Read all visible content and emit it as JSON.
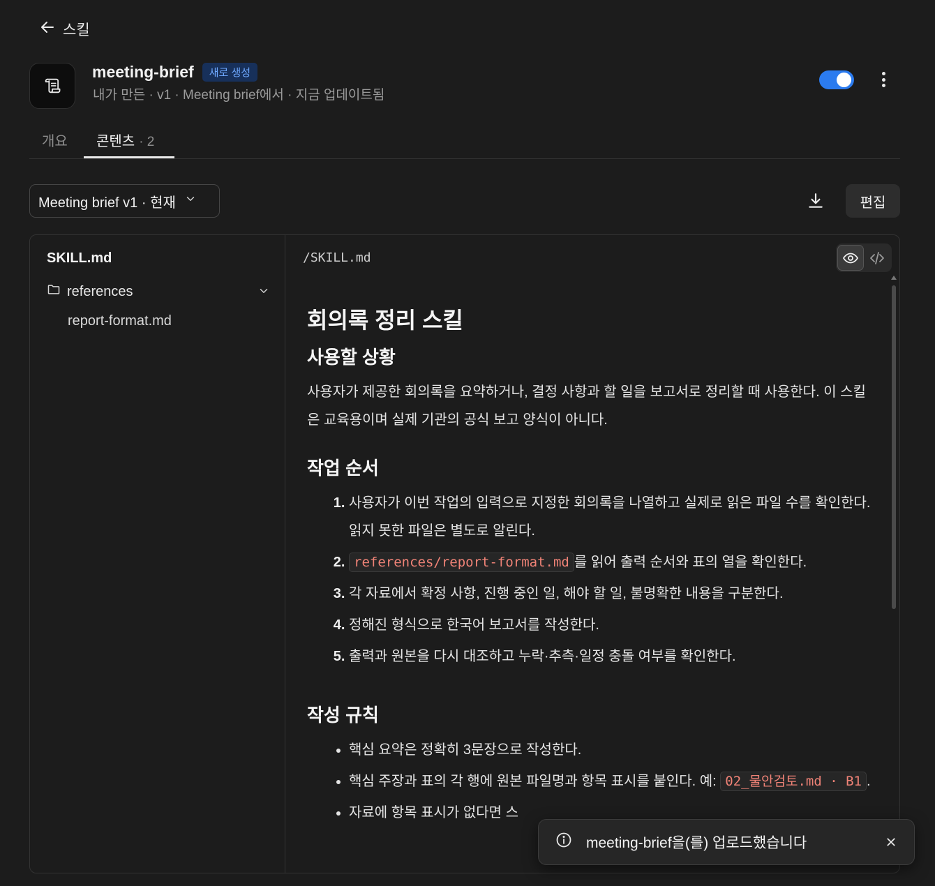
{
  "nav": {
    "back_label": "스킬"
  },
  "skill": {
    "name": "meeting-brief",
    "badge": "새로 생성",
    "meta": "내가 만든 · v1 · Meeting brief에서 · 지금 업데이트됨",
    "enabled": true
  },
  "tabs": [
    {
      "label": "개요",
      "active": false
    },
    {
      "label": "콘텐츠",
      "count": "· 2",
      "active": true
    }
  ],
  "toolbar": {
    "version_select": "Meeting brief v1 · 현재",
    "edit_label": "편집"
  },
  "file_tree": {
    "root_file": "SKILL.md",
    "folder": "references",
    "folder_files": [
      "report-format.md"
    ]
  },
  "viewer": {
    "path": "/SKILL.md",
    "mode": "preview"
  },
  "document": {
    "h1": "회의록 정리 스킬",
    "section1": {
      "heading": "사용할 상황",
      "body": "사용자가 제공한 회의록을 요약하거나, 결정 사항과 할 일을 보고서로 정리할 때 사용한다. 이 스킬은 교육용이며 실제 기관의 공식 보고 양식이 아니다."
    },
    "section2": {
      "heading": "작업 순서",
      "steps": [
        "사용자가 이번 작업의 입력으로 지정한 회의록을 나열하고 실제로 읽은 파일 수를 확인한다. 읽지 못한 파일은 별도로 알린다.",
        "references/report-format.md",
        "를 읽어 출력 순서와 표의 열을 확인한다.",
        "각 자료에서 확정 사항, 진행 중인 일, 해야 할 일, 불명확한 내용을 구분한다.",
        "정해진 형식으로 한국어 보고서를 작성한다.",
        "출력과 원본을 다시 대조하고 누락·추측·일정 충돌 여부를 확인한다."
      ]
    },
    "section3": {
      "heading": "작성 규칙",
      "rules": [
        "핵심 요약은 정확히 3문장으로 작성한다.",
        "핵심 주장과 표의 각 행에 원본 파일명과 항목 표시를 붙인다. 예: ",
        "02_물안검토.md · B1",
        ".",
        "자료에 항목 표시가 없다면 스"
      ]
    }
  },
  "toast": {
    "message": "meeting-brief을(를) 업로드했습니다"
  },
  "colors": {
    "accent": "#2b7bef",
    "badge_bg": "#17305a",
    "badge_text": "#6ea8ff",
    "code_text": "#f08377"
  }
}
